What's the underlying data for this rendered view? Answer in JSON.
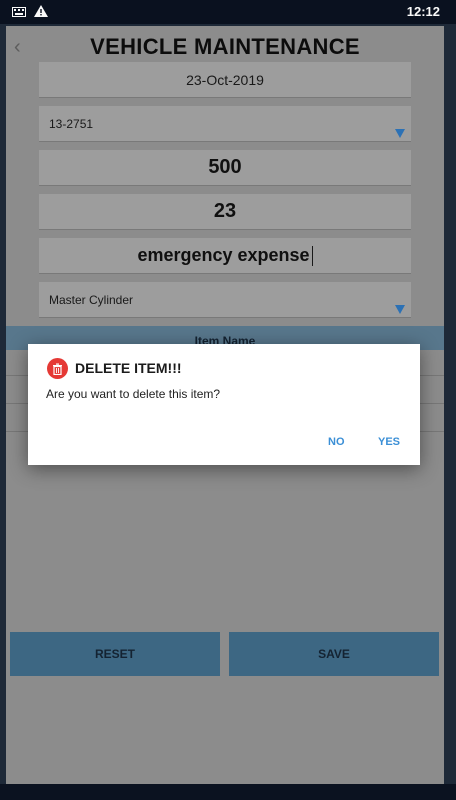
{
  "status_bar": {
    "time": "12:12",
    "icons": [
      "keyboard-icon",
      "warning-icon"
    ]
  },
  "header": {
    "title": "VEHICLE MAINTENANCE",
    "back_icon": "chevron-left-icon"
  },
  "form": {
    "date": "23-Oct-2019",
    "vehicle": "13-2751",
    "amount": "500",
    "quantity": "23",
    "description": "emergency expense",
    "item": "Master Cylinder"
  },
  "table": {
    "header": "Item Name"
  },
  "buttons": {
    "reset": "RESET",
    "save": "SAVE"
  },
  "dialog": {
    "title": "DELETE ITEM!!!",
    "message": "Are you want to delete this item?",
    "no": "NO",
    "yes": "YES"
  },
  "colors": {
    "accent": "#3b8fd6",
    "danger": "#e53935",
    "button": "#3f6a86"
  }
}
